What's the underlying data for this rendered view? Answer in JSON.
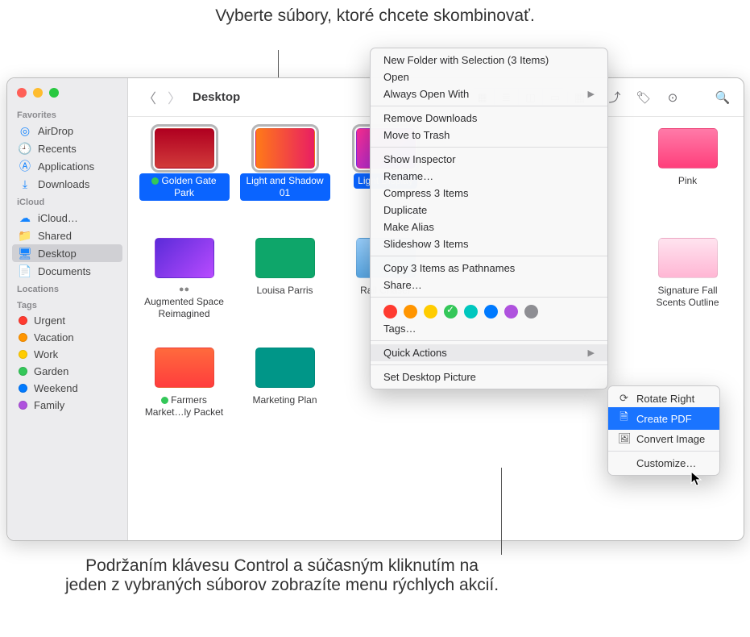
{
  "callouts": {
    "top": "Vyberte súbory, ktoré chcete skombinovať.",
    "bottom": "Podržaním klávesu Control a súčasným kliknutím na jeden z vybraných súborov zobrazíte menu rýchlych akcií."
  },
  "window": {
    "title": "Desktop"
  },
  "sidebar": {
    "sections": {
      "favorites": {
        "label": "Favorites",
        "items": [
          "AirDrop",
          "Recents",
          "Applications",
          "Downloads"
        ]
      },
      "icloud": {
        "label": "iCloud",
        "items": [
          "iCloud…",
          "Shared",
          "Desktop",
          "Documents"
        ]
      },
      "locations": {
        "label": "Locations"
      },
      "tags": {
        "label": "Tags",
        "items": [
          {
            "label": "Urgent",
            "color": "#ff3b30"
          },
          {
            "label": "Vacation",
            "color": "#ff9500"
          },
          {
            "label": "Work",
            "color": "#ffcc00"
          },
          {
            "label": "Garden",
            "color": "#34c759"
          },
          {
            "label": "Weekend",
            "color": "#007aff"
          },
          {
            "label": "Family",
            "color": "#af52de"
          }
        ]
      }
    }
  },
  "files": [
    {
      "label": "Golden Gate Park",
      "selected": true,
      "thumb": "t-gg",
      "tag": "#34c759"
    },
    {
      "label": "Light and Shadow 01",
      "selected": true,
      "thumb": "t-ls"
    },
    {
      "label": "Light Display",
      "selected": true,
      "thumb": "t-ld"
    },
    {
      "label": "",
      "selected": false,
      "thumb": "",
      "hidden": true
    },
    {
      "label": "",
      "selected": false,
      "thumb": "",
      "hidden": true
    },
    {
      "label": "Pink",
      "selected": false,
      "thumb": "t-pk"
    },
    {
      "label": "Augmented Space Reimagined",
      "selected": false,
      "thumb": "t-as",
      "sub": "●●"
    },
    {
      "label": "Louisa Parris",
      "selected": false,
      "thumb": "t-lp"
    },
    {
      "label": "Rail Chaser",
      "selected": false,
      "thumb": "t-rc"
    },
    {
      "label": "",
      "selected": false,
      "thumb": "",
      "hidden": true
    },
    {
      "label": "",
      "selected": false,
      "thumb": "",
      "hidden": true
    },
    {
      "label": "Signature Fall Scents Outline",
      "selected": false,
      "thumb": "t-fs"
    },
    {
      "label": "Farmers Market…ly Packet",
      "selected": false,
      "thumb": "t-fm",
      "tag": "#34c759"
    },
    {
      "label": "Marketing Plan",
      "selected": false,
      "thumb": "t-mp"
    }
  ],
  "context_menu": {
    "items": [
      "New Folder with Selection (3 Items)",
      "Open",
      "Always Open With",
      "—",
      "Remove Downloads",
      "Move to Trash",
      "—",
      "Show Inspector",
      "Rename…",
      "Compress 3 Items",
      "Duplicate",
      "Make Alias",
      "Slideshow 3 Items",
      "—",
      "Copy 3 Items as Pathnames",
      "Share…",
      "—",
      "TAGROW",
      "Tags…",
      "—",
      "Quick Actions",
      "—",
      "Set Desktop Picture"
    ],
    "tag_colors": [
      "#ff3b30",
      "#ff9500",
      "#ffcc00",
      "#34c759",
      "#00c7be",
      "#007aff",
      "#af52de",
      "#8e8e93"
    ]
  },
  "submenu": {
    "items": [
      "Rotate Right",
      "Create PDF",
      "Convert Image"
    ],
    "customize": "Customize…"
  }
}
